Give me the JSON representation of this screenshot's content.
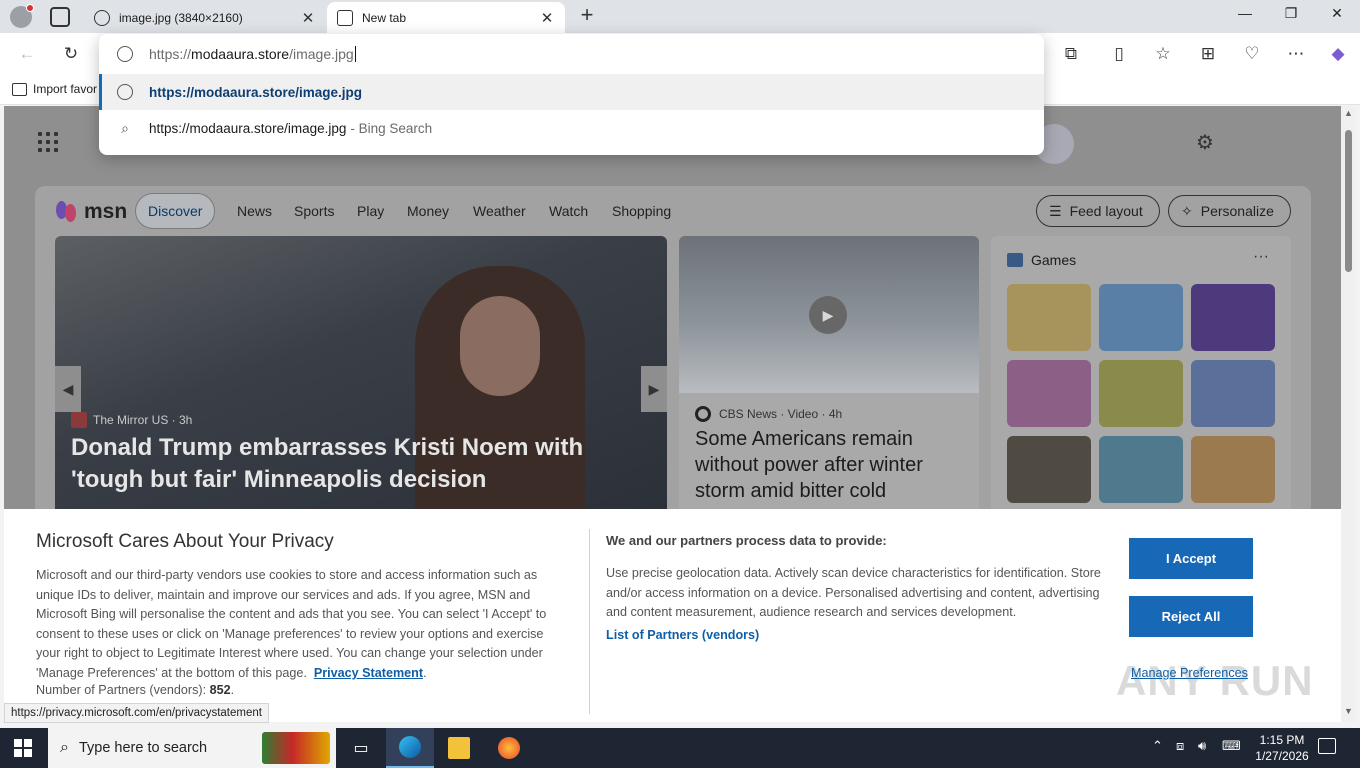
{
  "browser": {
    "tabs": [
      {
        "label": "image.jpg (3840×2160)",
        "active": false
      },
      {
        "label": "New tab",
        "active": true
      }
    ],
    "new_tab_label": "+",
    "window_controls": {
      "minimize": "—",
      "restore": "❐",
      "close": "✕"
    },
    "favorites_bar": {
      "import_label": "Import favor"
    }
  },
  "omnibox": {
    "value_prefix": "https://",
    "value_host": "modaaura.store",
    "value_path": "/image.jpg",
    "suggestions": [
      {
        "label": "https://modaaura.store/image.jpg",
        "suffix": ""
      },
      {
        "label": "https://modaaura.store/image.jpg",
        "suffix": "- Bing Search"
      }
    ]
  },
  "msn": {
    "logo": "msn",
    "nav": {
      "discover": "Discover",
      "items": [
        "News",
        "Sports",
        "Play",
        "Money",
        "Weather",
        "Watch",
        "Shopping"
      ]
    },
    "feed_layout_label": "Feed layout",
    "personalize_label": "Personalize",
    "hero": {
      "source": "The Mirror US · 3h",
      "headline": "Donald Trump embarrasses Kristi Noem with 'tough but fair' Minneapolis decision"
    },
    "card2": {
      "source": "CBS News · Video · 4h",
      "title": "Some Americans remain without power after winter storm amid bitter cold"
    },
    "games": {
      "title": "Games",
      "more": "···"
    }
  },
  "privacy": {
    "title": "Microsoft Cares About Your Privacy",
    "body": "Microsoft and our third-party vendors use cookies to store and access information such as unique IDs to deliver, maintain and improve our services and ads. If you agree, MSN and Microsoft Bing will personalise the content and ads that you see. You can select 'I Accept' to consent to these uses or click on 'Manage preferences' to review your options and exercise your right to object to Legitimate Interest where used. You can change your selection under 'Manage Preferences' at the bottom of this page.",
    "privacy_link": "Privacy Statement",
    "partners_label": "Number of Partners (vendors):",
    "partners_count": "852",
    "right_heading": "We and our partners process data to provide:",
    "right_body": "Use precise geolocation data. Actively scan device characteristics for identification. Store and/or access information on a device. Personalised advertising and content, advertising and content measurement, audience research and services development.",
    "partners_link": "List of Partners (vendors)",
    "accept_label": "I Accept",
    "reject_label": "Reject All",
    "manage_label": "Manage Preferences"
  },
  "watermark": "ANY RUN",
  "status_url": "https://privacy.microsoft.com/en/privacystatement",
  "taskbar": {
    "search_placeholder": "Type here to search",
    "time": "1:15 PM",
    "date": "1/27/2026"
  }
}
